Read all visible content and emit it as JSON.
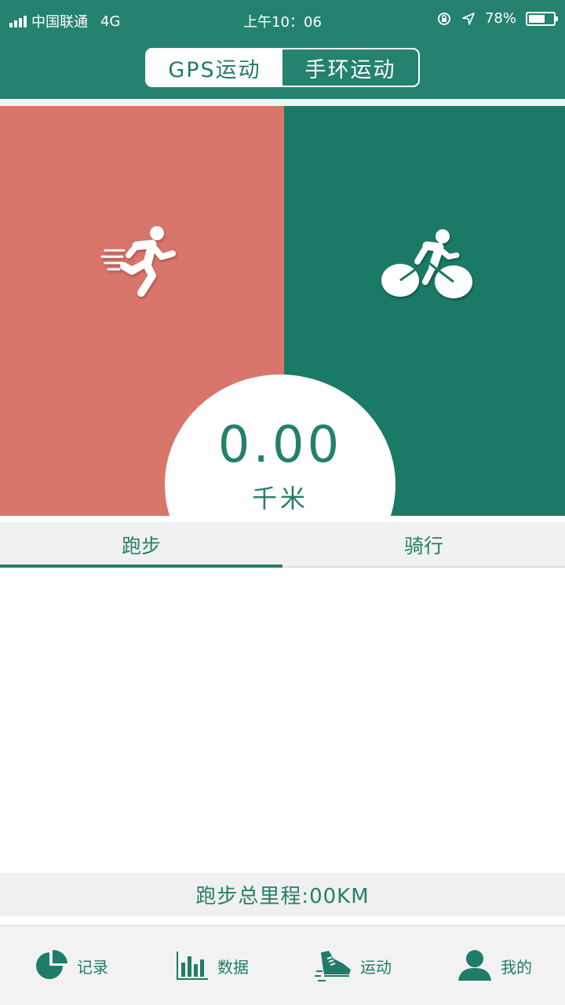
{
  "status_bar": {
    "carrier": "中国联通",
    "network": "4G",
    "time": "上午10：06",
    "battery_percent": "78%",
    "battery_level": 0.78
  },
  "header": {
    "segments": [
      {
        "label": "GPS运动",
        "active": true
      },
      {
        "label": "手环运动",
        "active": false
      }
    ]
  },
  "hero": {
    "panels": [
      {
        "icon": "running-icon",
        "color": "#d8766c"
      },
      {
        "icon": "cycling-icon",
        "color": "#1b7a66"
      }
    ],
    "distance_value": "0.00",
    "distance_unit": "千米"
  },
  "tabs": [
    {
      "label": "跑步",
      "active": true
    },
    {
      "label": "骑行",
      "active": false
    }
  ],
  "total": {
    "label": "跑步总里程:00KM"
  },
  "bottom_nav": [
    {
      "label": "记录",
      "icon": "pie-chart-icon"
    },
    {
      "label": "数据",
      "icon": "bar-chart-icon"
    },
    {
      "label": "运动",
      "icon": "sneaker-icon"
    },
    {
      "label": "我的",
      "icon": "user-icon"
    }
  ],
  "colors": {
    "brand": "#25826f",
    "run_panel": "#d8766c",
    "bike_panel": "#1b7a66",
    "accent_text": "#24806b"
  }
}
